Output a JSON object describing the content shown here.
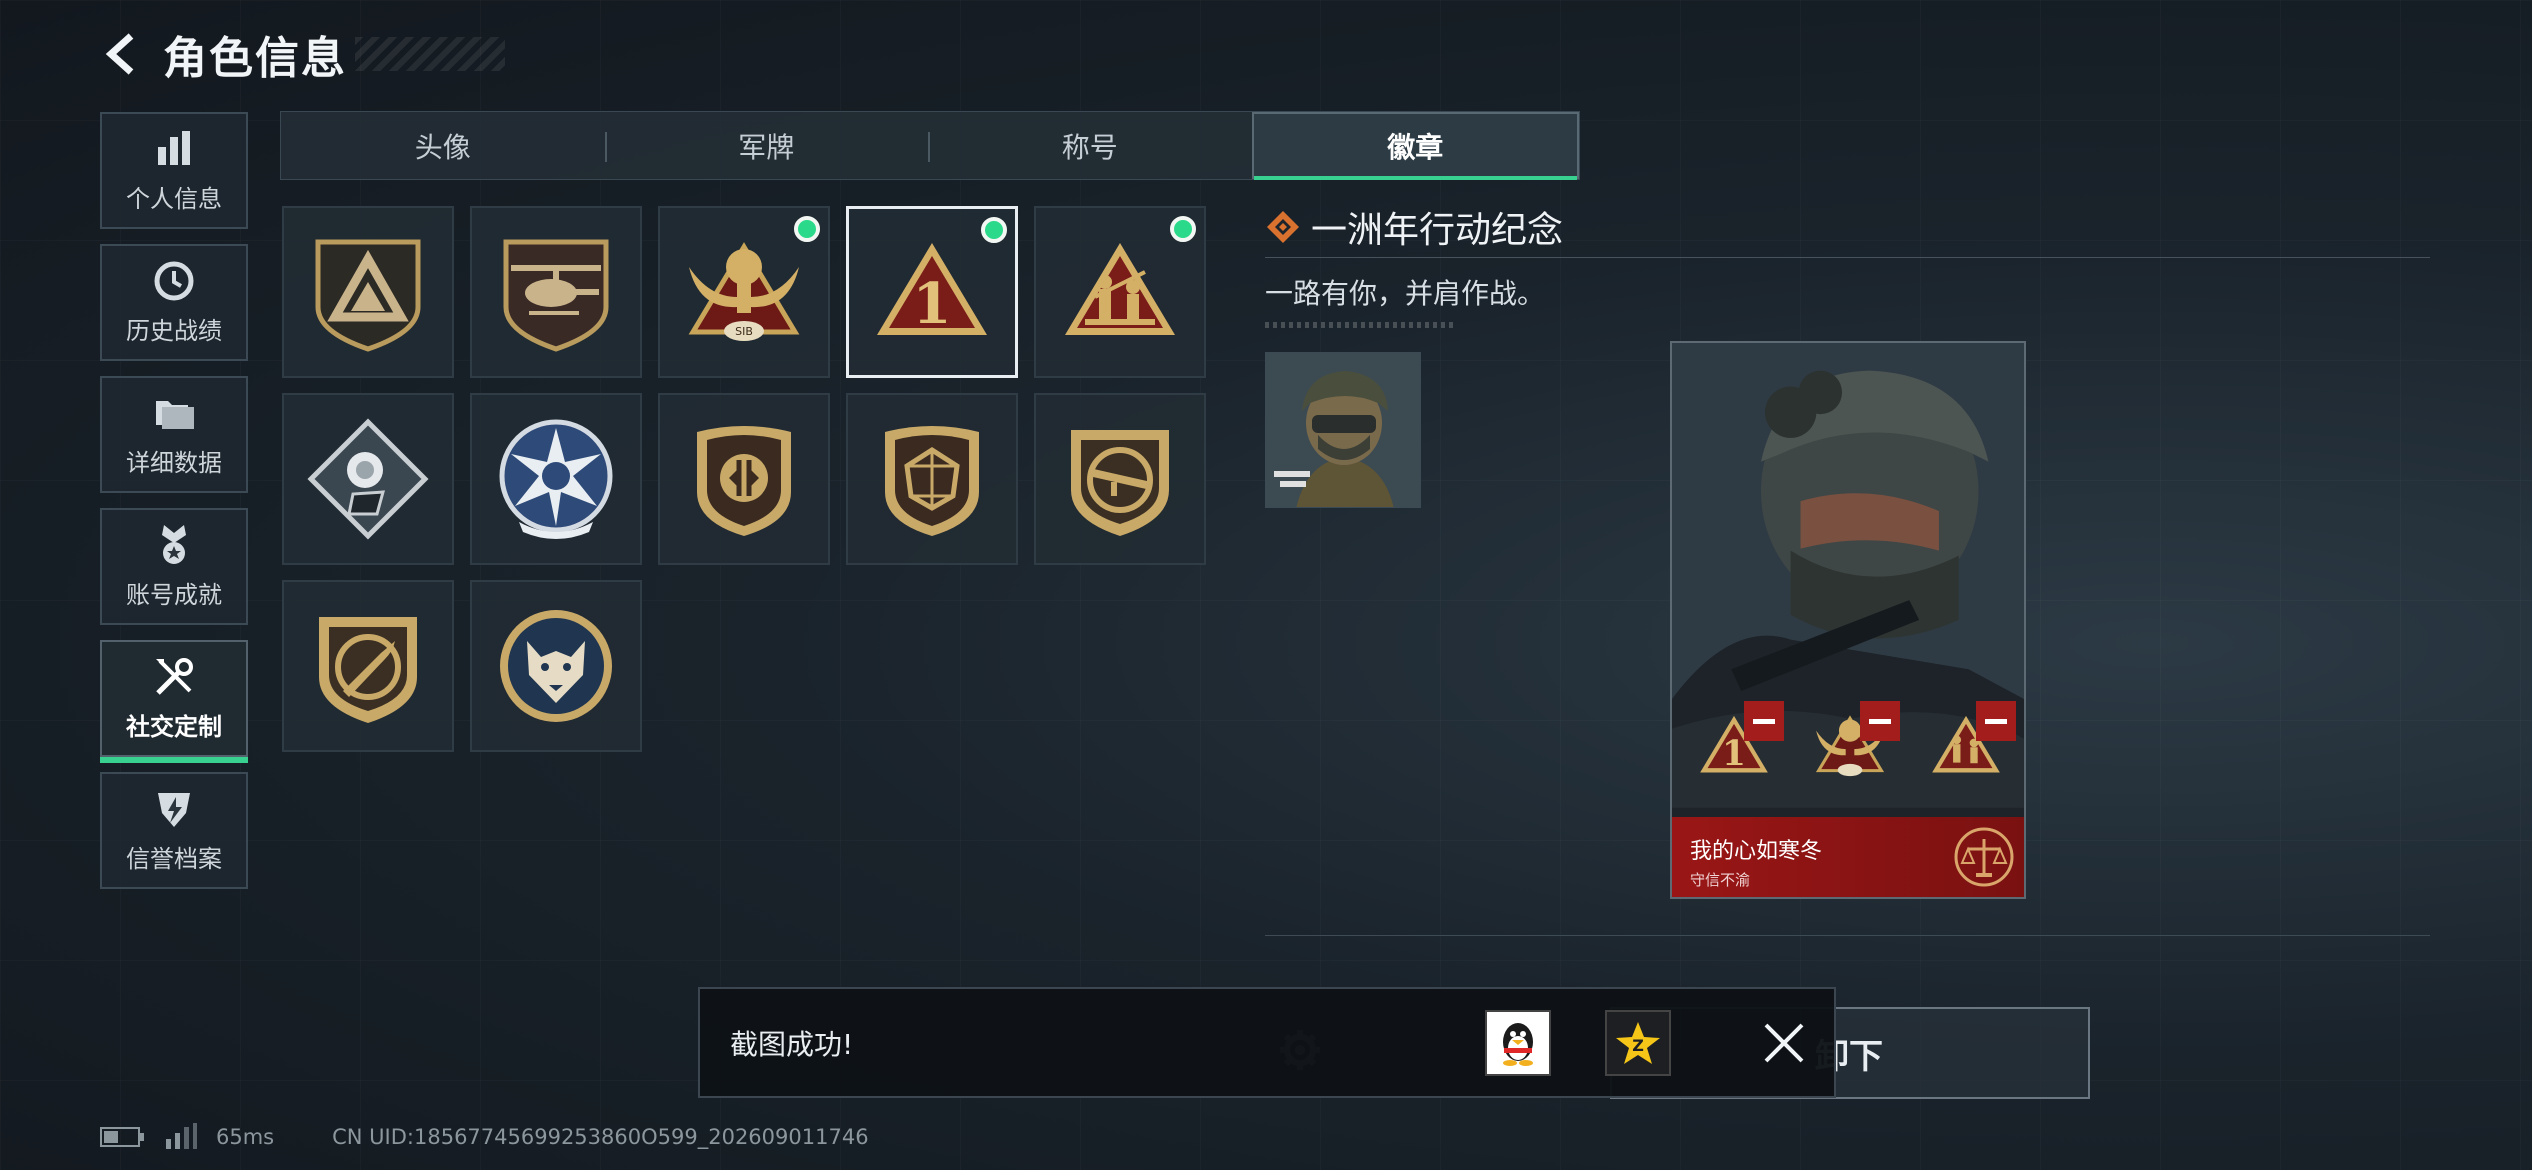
{
  "header": {
    "title": "角色信息",
    "back_icon": "chevron-left-icon"
  },
  "sidebar": {
    "items": [
      {
        "label": "个人信息",
        "icon": "bar-chart-icon",
        "active": false
      },
      {
        "label": "历史战绩",
        "icon": "clock-icon",
        "active": false
      },
      {
        "label": "详细数据",
        "icon": "folder-icon",
        "active": false
      },
      {
        "label": "账号成就",
        "icon": "medal-icon",
        "active": false
      },
      {
        "label": "社交定制",
        "icon": "tools-icon",
        "active": true
      },
      {
        "label": "信誉档案",
        "icon": "shield-icon",
        "active": false
      }
    ]
  },
  "tabs": [
    {
      "label": "头像",
      "active": false
    },
    {
      "label": "军牌",
      "active": false
    },
    {
      "label": "称号",
      "active": false
    },
    {
      "label": "徽章",
      "active": true
    }
  ],
  "badges": [
    {
      "name": "triangle-shield-badge",
      "equipped": false,
      "selected": false
    },
    {
      "name": "helicopter-badge",
      "equipped": false,
      "selected": false
    },
    {
      "name": "winged-sib-badge",
      "equipped": true,
      "selected": false
    },
    {
      "name": "number-one-triangle-badge",
      "equipped": true,
      "selected": true
    },
    {
      "name": "soldiers-triangle-badge",
      "equipped": true,
      "selected": false
    },
    {
      "name": "rose-diamond-badge",
      "equipped": false,
      "selected": false
    },
    {
      "name": "star-skull-badge",
      "equipped": false,
      "selected": false
    },
    {
      "name": "split-shield-badge",
      "equipped": false,
      "selected": false
    },
    {
      "name": "dice-shield-badge",
      "equipped": false,
      "selected": false
    },
    {
      "name": "rifle-shield-badge",
      "equipped": false,
      "selected": false
    },
    {
      "name": "bullet-shield-badge",
      "equipped": false,
      "selected": false
    },
    {
      "name": "wolf-round-badge",
      "equipped": false,
      "selected": false
    }
  ],
  "detail": {
    "title": "一洲年行动纪念",
    "description": "一路有你，并肩作战。"
  },
  "card": {
    "name": "我的心如寒冬",
    "subtitle": "守信不渝",
    "equipped_badge_icons": [
      "number-one-triangle-badge",
      "winged-sib-badge",
      "soldiers-triangle-badge"
    ]
  },
  "actions": {
    "unequip_label": "卸下"
  },
  "toast": {
    "message": "截图成功!"
  },
  "status": {
    "ping": "65ms",
    "uid": "CN UID:18567745699253860O599_202609011746"
  },
  "colors": {
    "accent": "#39d18f",
    "equip_dot": "#2bd98a",
    "card_red": "#9a1616"
  }
}
